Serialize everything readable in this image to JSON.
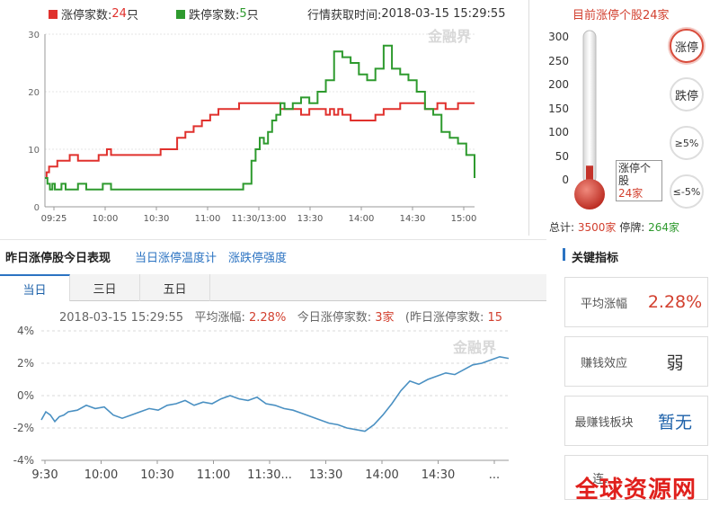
{
  "top": {
    "legend_up_label": "涨停家数: ",
    "legend_up_value": "24",
    "legend_up_unit": "只",
    "legend_down_label": "跌停家数: ",
    "legend_down_value": "5",
    "legend_down_unit": "只",
    "time_label": "行情获取时间: ",
    "time_value": "2018-03-15 15:29:55",
    "watermark": "金融界"
  },
  "thermo": {
    "title": "目前涨停个股24家",
    "ticks": [
      "300",
      "250",
      "200",
      "150",
      "100",
      "50",
      "0"
    ],
    "callout_text": "涨停个股",
    "callout_count": "24家",
    "level": 24,
    "max": 300,
    "buttons": [
      "涨停",
      "跌停",
      "≥5%",
      "≤-5%"
    ],
    "total_label": "总计: ",
    "total_value": "3500家",
    "halt_label": " 停牌: ",
    "halt_value": "264家"
  },
  "section": {
    "title": "昨日涨停股今日表现",
    "link1": "当日涨停温度计",
    "link2": "涨跌停强度",
    "key_title": "关键指标"
  },
  "tabs": [
    "当日",
    "三日",
    "五日"
  ],
  "bottom_info": {
    "time": "2018-03-15 15:29:55",
    "avg_label": "平均涨幅: ",
    "avg_value": "2.28%",
    "today_label": "今日涨停家数: ",
    "today_value": "3家",
    "yest_label": "(昨日涨停家数: ",
    "yest_value": "15"
  },
  "kpis": [
    {
      "label": "平均涨幅",
      "value": "2.28%",
      "color": "#d23f2e"
    },
    {
      "label": "赚钱效应",
      "value": "弱",
      "color": "#333333"
    },
    {
      "label": "最赚钱板块",
      "value": "暂无",
      "color": "#1a5fa8"
    },
    {
      "label": "连...",
      "value": "",
      "color": "#333333"
    }
  ],
  "site_watermark": "全球资源网",
  "colors": {
    "up": "#e0312d",
    "down": "#2e9a2e",
    "blue": "#4a90c2",
    "accent": "#d23f2e"
  },
  "chart_data": [
    {
      "type": "line",
      "x_ticks": [
        "09:25",
        "10:00",
        "10:30",
        "11:00",
        "11:30/13:00",
        "13:30",
        "14:00",
        "14:30",
        "15:00"
      ],
      "y_ticks": [
        "30",
        "20",
        "10",
        "0"
      ],
      "ylim": [
        0,
        30
      ],
      "series": [
        {
          "name": "涨停家数",
          "color": "#e0312d",
          "t": [
            0,
            2,
            5,
            10,
            15,
            20,
            30,
            40,
            50,
            60,
            65,
            70,
            75,
            80,
            85,
            90,
            95,
            100,
            110,
            120,
            130,
            140,
            150,
            160,
            170,
            180,
            190,
            200,
            210,
            220,
            230,
            235,
            240,
            245,
            250,
            255,
            260,
            265,
            270,
            275,
            280,
            285,
            290,
            300,
            310,
            320,
            330,
            340,
            345,
            350,
            355,
            360,
            370,
            380,
            390,
            400,
            410,
            420,
            430,
            440,
            450,
            460,
            470,
            475,
            480,
            485,
            490,
            500,
            510,
            520
          ],
          "v": [
            5,
            6,
            7,
            7,
            8,
            8,
            9,
            8,
            8,
            8,
            9,
            9,
            10,
            9,
            9,
            9,
            9,
            9,
            9,
            9,
            9,
            10,
            10,
            12,
            13,
            14,
            15,
            16,
            17,
            17,
            17,
            18,
            18,
            18,
            18,
            18,
            18,
            18,
            18,
            18,
            18,
            17,
            17,
            17,
            16,
            17,
            17,
            16,
            17,
            16,
            17,
            16,
            15,
            15,
            15,
            16,
            17,
            17,
            18,
            18,
            18,
            17,
            17,
            18,
            18,
            17,
            17,
            18,
            18,
            18
          ]
        },
        {
          "name": "跌停家数",
          "color": "#2e9a2e",
          "t": [
            0,
            3,
            6,
            9,
            12,
            15,
            20,
            25,
            30,
            40,
            50,
            60,
            70,
            80,
            90,
            100,
            110,
            120,
            130,
            140,
            150,
            160,
            170,
            180,
            190,
            200,
            210,
            220,
            230,
            240,
            250,
            255,
            260,
            265,
            270,
            275,
            280,
            285,
            290,
            300,
            310,
            320,
            330,
            340,
            350,
            360,
            370,
            380,
            390,
            400,
            410,
            420,
            430,
            440,
            450,
            460,
            470,
            480,
            490,
            500,
            510,
            520
          ],
          "v": [
            5,
            4,
            3,
            4,
            3,
            3,
            4,
            3,
            3,
            4,
            3,
            3,
            4,
            3,
            3,
            3,
            3,
            3,
            3,
            3,
            3,
            3,
            3,
            3,
            3,
            3,
            3,
            3,
            3,
            4,
            8,
            10,
            12,
            11,
            13,
            15,
            16,
            18,
            17,
            18,
            19,
            18,
            20,
            22,
            27,
            26,
            25,
            23,
            22,
            24,
            28,
            24,
            23,
            22,
            20,
            17,
            16,
            13,
            12,
            11,
            9,
            5
          ]
        }
      ]
    },
    {
      "type": "line",
      "x_ticks": [
        "9:30",
        "10:00",
        "10:30",
        "11:00",
        "11:30...",
        "13:30",
        "14:00",
        "14:30",
        "..."
      ],
      "y_ticks": [
        "4%",
        "2%",
        "0%",
        "-2%",
        "-4%"
      ],
      "ylim": [
        -4,
        4
      ],
      "series": [
        {
          "name": "平均涨幅",
          "color": "#4a90c2",
          "t": [
            0,
            5,
            10,
            15,
            20,
            25,
            30,
            40,
            50,
            60,
            70,
            80,
            90,
            100,
            110,
            120,
            130,
            140,
            150,
            160,
            170,
            180,
            190,
            200,
            210,
            220,
            230,
            240,
            250,
            260,
            270,
            280,
            290,
            300,
            310,
            320,
            330,
            340,
            350,
            360,
            370,
            380,
            390,
            400,
            410,
            420,
            430,
            440,
            450,
            460,
            470,
            480,
            490,
            500,
            510,
            520
          ],
          "v": [
            -1.5,
            -1.0,
            -1.2,
            -1.6,
            -1.3,
            -1.2,
            -1.0,
            -0.9,
            -0.6,
            -0.8,
            -0.7,
            -1.2,
            -1.4,
            -1.2,
            -1.0,
            -0.8,
            -0.9,
            -0.6,
            -0.5,
            -0.3,
            -0.6,
            -0.4,
            -0.5,
            -0.2,
            0.0,
            -0.2,
            -0.3,
            -0.1,
            -0.5,
            -0.6,
            -0.8,
            -0.9,
            -1.1,
            -1.3,
            -1.5,
            -1.7,
            -1.8,
            -2.0,
            -2.1,
            -2.2,
            -1.8,
            -1.2,
            -0.5,
            0.3,
            0.9,
            0.7,
            1.0,
            1.2,
            1.4,
            1.3,
            1.6,
            1.9,
            2.0,
            2.2,
            2.4,
            2.3
          ]
        }
      ]
    }
  ]
}
